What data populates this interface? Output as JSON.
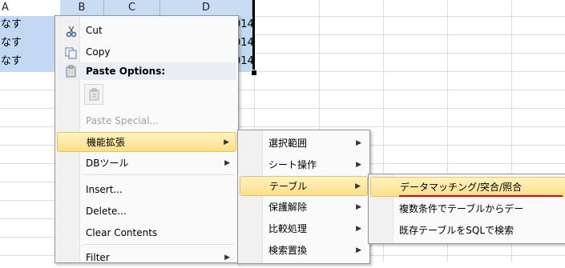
{
  "columns": [
    "A",
    "B",
    "C",
    "D"
  ],
  "cells": {
    "row1_a": "なす",
    "row2_a": "なす",
    "row3_a": "なす",
    "row1_e": "014",
    "row2_e": "014",
    "row3_e": "014"
  },
  "context_menu": {
    "cut": "Cut",
    "copy": "Copy",
    "paste_options": "Paste Options:",
    "paste_special": "Paste Special...",
    "kinou": "機能拡張",
    "db_tool": "DBツール",
    "insert": "Insert...",
    "delete": "Delete...",
    "clear": "Clear Contents",
    "filter": "Filter"
  },
  "submenu1": {
    "sentaku": "選択範囲",
    "sheet": "シート操作",
    "table": "テーブル",
    "hogo": "保護解除",
    "hikaku": "比較処理",
    "kensaku": "検索置換"
  },
  "submenu2": {
    "matching": "データマッチング/突合/照合",
    "fukusu": "複数条件でテーブルからデー",
    "kizon": "既存テーブルをSQLで検索"
  },
  "colors": {
    "highlight": "#fddf8b",
    "selection": "#c3d8f2",
    "underline": "#e00000"
  }
}
